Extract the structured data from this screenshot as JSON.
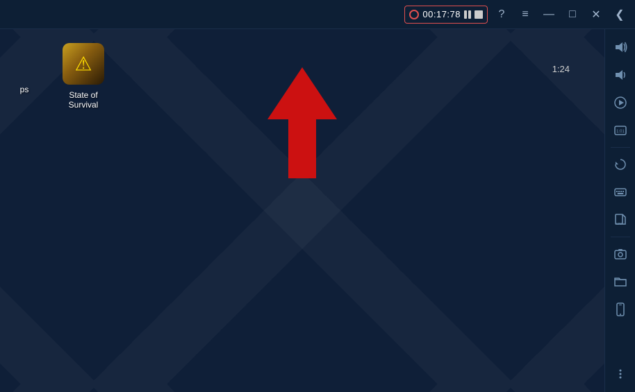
{
  "titlebar": {
    "recorder": {
      "time": "00:17:78",
      "pause_label": "pause",
      "stop_label": "stop"
    },
    "help_label": "?",
    "menu_label": "≡",
    "minimize_label": "—",
    "maximize_label": "□",
    "close_label": "✕",
    "back_label": "❮"
  },
  "desktop": {
    "time": "1:24",
    "apps_partial_label": "ps",
    "app_icon": {
      "label": "State of Survival"
    }
  },
  "sidebar": {
    "icons": [
      {
        "name": "volume-up-icon",
        "symbol": "🔊"
      },
      {
        "name": "volume-down-icon",
        "symbol": "🔉"
      },
      {
        "name": "play-icon",
        "symbol": "▶"
      },
      {
        "name": "screen-record-icon",
        "symbol": "⏱"
      },
      {
        "name": "rotate-icon",
        "symbol": "⟳"
      },
      {
        "name": "keyboard-icon",
        "symbol": "⌨"
      },
      {
        "name": "apk-icon",
        "symbol": "APK"
      },
      {
        "name": "screenshot-icon",
        "symbol": "📷"
      },
      {
        "name": "folder-icon",
        "symbol": "📁"
      },
      {
        "name": "phone-icon",
        "symbol": "📱"
      },
      {
        "name": "more-icon",
        "symbol": "•••"
      }
    ]
  }
}
